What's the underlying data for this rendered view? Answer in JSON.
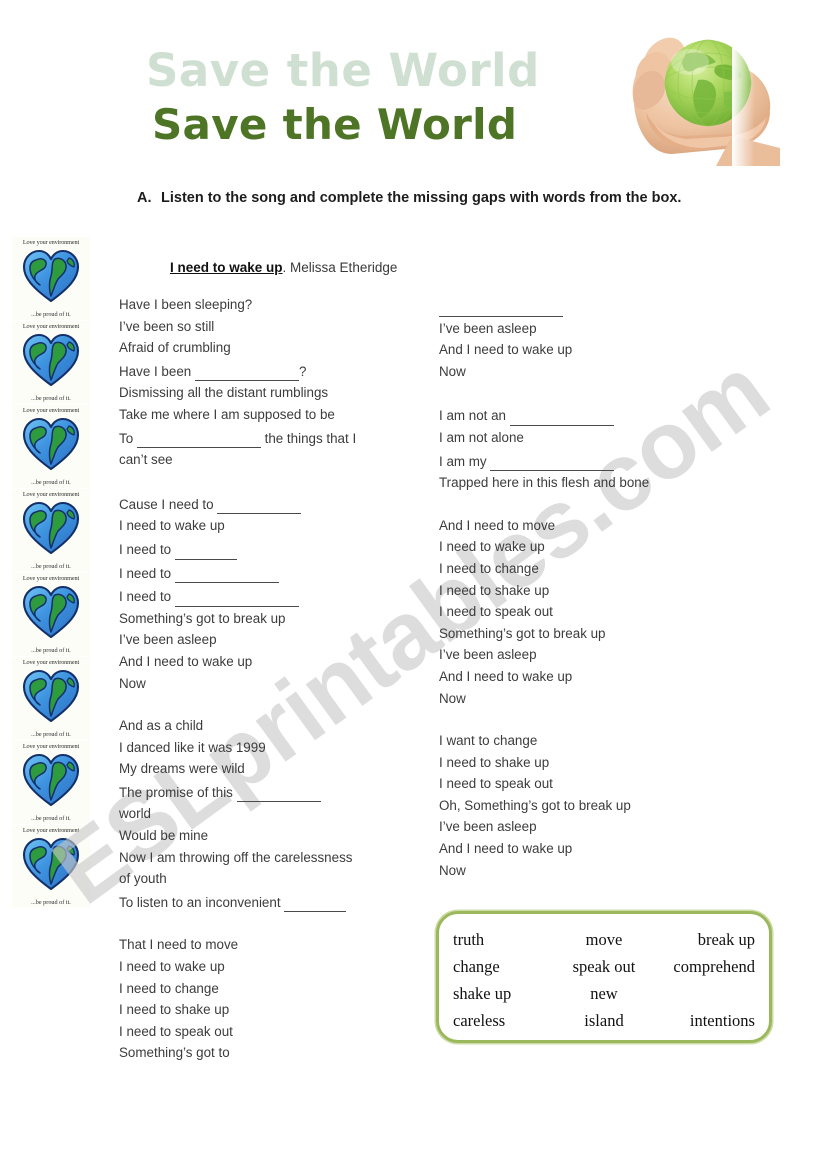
{
  "page": {
    "watermark": "ESLprintables.com"
  },
  "header": {
    "title_ghost": "Save the World",
    "title_main": "Save the World",
    "hero_image_name": "hands-holding-green-globe"
  },
  "stickers": {
    "caption_top": "Love your environment",
    "caption_bottom": "...be proud of it.",
    "count": 8
  },
  "instruction": {
    "letter": "A.",
    "text": "Listen to the song and complete the missing gaps with words from the box."
  },
  "song": {
    "title": "I need to wake up",
    "separator": ". ",
    "artist": "Melissa Etheridge"
  },
  "lyrics": {
    "left": [
      {
        "lines": [
          [
            {
              "t": "text",
              "v": "Have I been sleeping?"
            }
          ],
          [
            {
              "t": "text",
              "v": "I’ve been so still"
            }
          ],
          [
            {
              "t": "text",
              "v": "Afraid of crumbling"
            }
          ],
          [
            {
              "t": "text",
              "v": "Have I been "
            },
            {
              "t": "gap",
              "size": "lg"
            },
            {
              "t": "text",
              "v": "?"
            }
          ],
          [
            {
              "t": "text",
              "v": "Dismissing all the distant rumblings"
            }
          ],
          [
            {
              "t": "text",
              "v": "Take me where I am supposed to be"
            }
          ],
          [
            {
              "t": "text",
              "v": "To "
            },
            {
              "t": "gap",
              "size": "xl"
            },
            {
              "t": "text",
              "v": " the things that I"
            }
          ],
          [
            {
              "t": "text",
              "v": "can’t see"
            }
          ]
        ]
      },
      {
        "lines": [
          [
            {
              "t": "text",
              "v": "Cause I need to "
            },
            {
              "t": "gap",
              "size": "md"
            }
          ],
          [
            {
              "t": "text",
              "v": "I need to wake up"
            }
          ],
          [
            {
              "t": "text",
              "v": "I need to "
            },
            {
              "t": "gap",
              "size": "sm"
            }
          ],
          [
            {
              "t": "text",
              "v": "I need to "
            },
            {
              "t": "gap",
              "size": "lg"
            }
          ],
          [
            {
              "t": "text",
              "v": "I need to "
            },
            {
              "t": "gap",
              "size": "xl"
            }
          ],
          [
            {
              "t": "text",
              "v": "Something’s got to break up"
            }
          ],
          [
            {
              "t": "text",
              "v": "I’ve been asleep"
            }
          ],
          [
            {
              "t": "text",
              "v": "And I need to wake up"
            }
          ],
          [
            {
              "t": "text",
              "v": "Now"
            }
          ]
        ]
      },
      {
        "lines": [
          [
            {
              "t": "text",
              "v": "And as a child"
            }
          ],
          [
            {
              "t": "text",
              "v": "I danced like it was 1999"
            }
          ],
          [
            {
              "t": "text",
              "v": "My dreams were wild"
            }
          ],
          [
            {
              "t": "text",
              "v": "The promise of this "
            },
            {
              "t": "gap",
              "size": "md"
            }
          ],
          [
            {
              "t": "text",
              "v": "world"
            }
          ],
          [
            {
              "t": "text",
              "v": "Would be mine"
            }
          ],
          [
            {
              "t": "text",
              "v": "Now I am throwing off the carelessness"
            }
          ],
          [
            {
              "t": "text",
              "v": "of youth"
            }
          ],
          [
            {
              "t": "text",
              "v": "To listen to an inconvenient "
            },
            {
              "t": "gap",
              "size": "sm"
            }
          ]
        ]
      },
      {
        "lines": [
          [
            {
              "t": "text",
              "v": "That I need to move"
            }
          ],
          [
            {
              "t": "text",
              "v": "I need to wake up"
            }
          ],
          [
            {
              "t": "text",
              "v": "I need to change"
            }
          ],
          [
            {
              "t": "text",
              "v": "I need to shake up"
            }
          ],
          [
            {
              "t": "text",
              "v": "I need to speak out"
            }
          ],
          [
            {
              "t": "text",
              "v": "Something’s got to"
            }
          ]
        ]
      }
    ],
    "right": [
      {
        "lines": [
          [
            {
              "t": "gap",
              "size": "xl"
            }
          ],
          [
            {
              "t": "text",
              "v": "I’ve been asleep"
            }
          ],
          [
            {
              "t": "text",
              "v": "And I need to wake up"
            }
          ],
          [
            {
              "t": "text",
              "v": "Now"
            }
          ]
        ]
      },
      {
        "lines": [
          [
            {
              "t": "text",
              "v": "I am not an "
            },
            {
              "t": "gap",
              "size": "lg"
            }
          ],
          [
            {
              "t": "text",
              "v": "I am not alone"
            }
          ],
          [
            {
              "t": "text",
              "v": "I am my "
            },
            {
              "t": "gap",
              "size": "xl"
            }
          ],
          [
            {
              "t": "text",
              "v": "Trapped here in this flesh and bone"
            }
          ]
        ]
      },
      {
        "lines": [
          [
            {
              "t": "text",
              "v": "And I need to move"
            }
          ],
          [
            {
              "t": "text",
              "v": "I need to wake up"
            }
          ],
          [
            {
              "t": "text",
              "v": "I need to change"
            }
          ],
          [
            {
              "t": "text",
              "v": "I need to shake up"
            }
          ],
          [
            {
              "t": "text",
              "v": "I need to speak out"
            }
          ],
          [
            {
              "t": "text",
              "v": "Something’s got to break up"
            }
          ],
          [
            {
              "t": "text",
              "v": "I’ve been asleep"
            }
          ],
          [
            {
              "t": "text",
              "v": "And I need to wake up"
            }
          ],
          [
            {
              "t": "text",
              "v": "Now"
            }
          ]
        ]
      },
      {
        "lines": [
          [
            {
              "t": "text",
              "v": "I want to change"
            }
          ],
          [
            {
              "t": "text",
              "v": "I need to shake up"
            }
          ],
          [
            {
              "t": "text",
              "v": "I need to speak out"
            }
          ],
          [
            {
              "t": "text",
              "v": "Oh, Something’s got to break up"
            }
          ],
          [
            {
              "t": "text",
              "v": "I’ve been asleep"
            }
          ],
          [
            {
              "t": "text",
              "v": "And I need to wake up"
            }
          ],
          [
            {
              "t": "text",
              "v": "Now"
            }
          ]
        ]
      }
    ]
  },
  "word_bank": {
    "rows": [
      [
        "truth",
        "move",
        "break  up"
      ],
      [
        "change",
        "speak out",
        "comprehend"
      ],
      [
        "shake up",
        "new",
        ""
      ],
      [
        "careless",
        "island",
        "intentions"
      ]
    ],
    "border_color": "#9cb85c"
  },
  "colors": {
    "title_dark_green": "#4e7425",
    "title_ghost_green": "#cfe0d2",
    "word_bank_green": "#9cb85c",
    "lyric_text": "#3c3c3c",
    "watermark_gray": "#c9c9c9"
  }
}
